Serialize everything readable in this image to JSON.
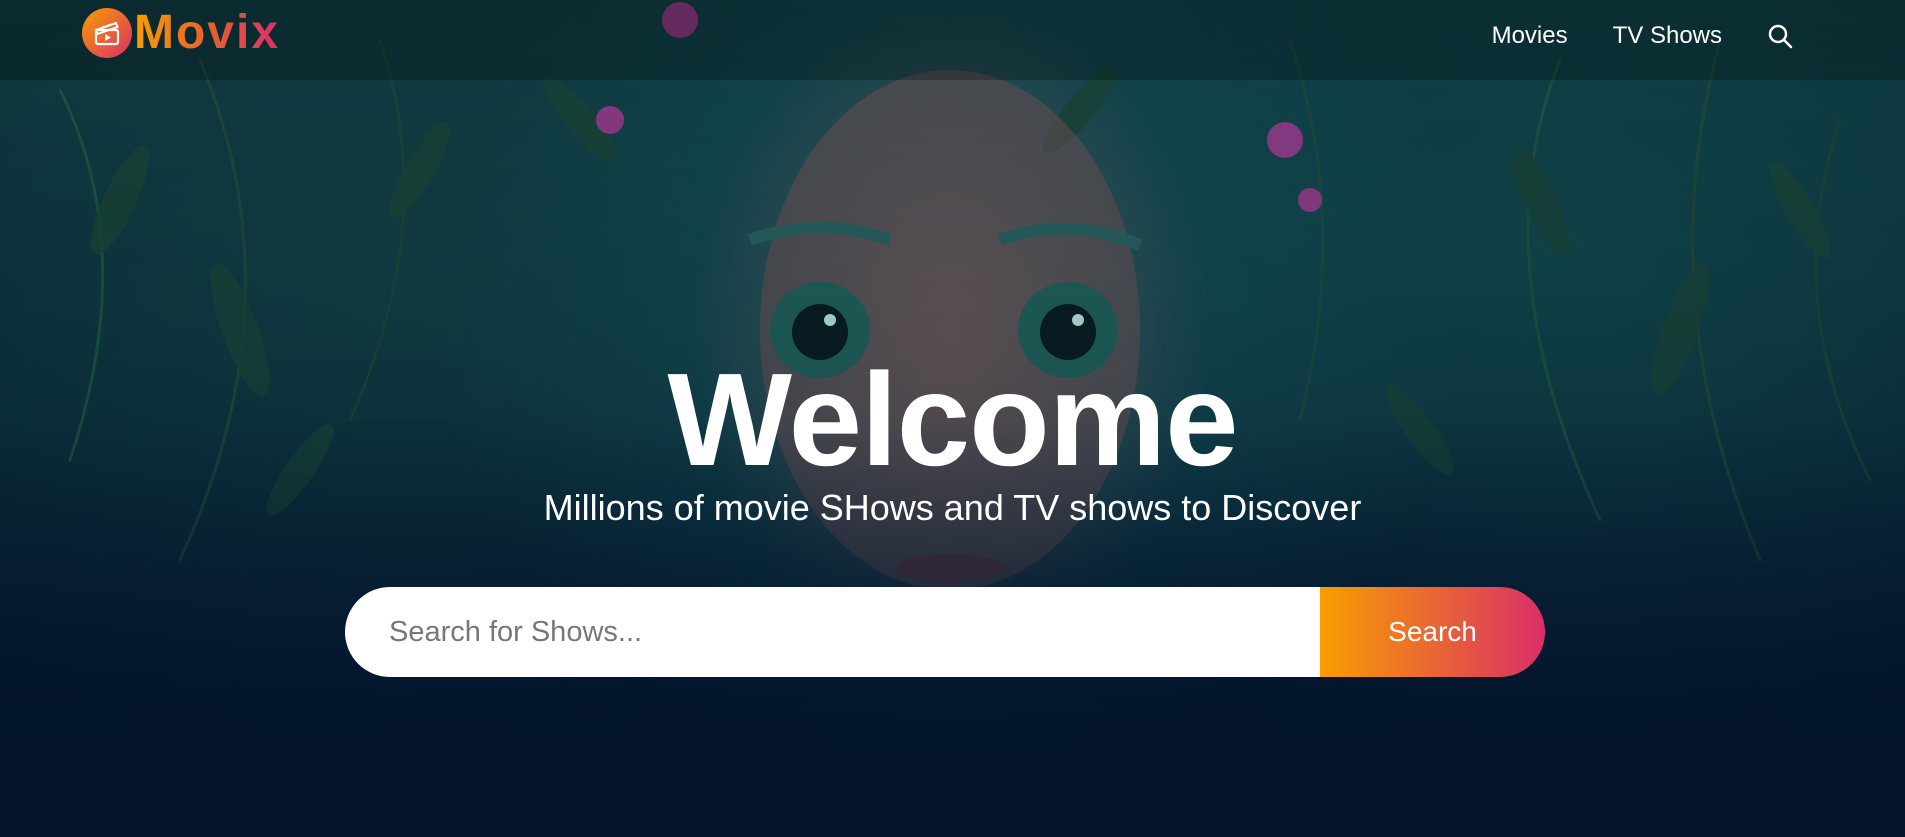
{
  "header": {
    "logo_text": "Movix",
    "logo_icon": "clapperboard-icon",
    "nav": {
      "movies_label": "Movies",
      "tv_shows_label": "TV Shows",
      "search_icon": "search-icon"
    }
  },
  "hero": {
    "title": "Welcome",
    "subtitle": "Millions of movie SHows and TV shows to Discover",
    "search": {
      "placeholder": "Search for Shows...",
      "value": "",
      "button_label": "Search"
    }
  },
  "colors": {
    "accent_start": "#f89e00",
    "accent_end": "#da2f68",
    "background": "#04152d",
    "text": "#ffffff"
  }
}
